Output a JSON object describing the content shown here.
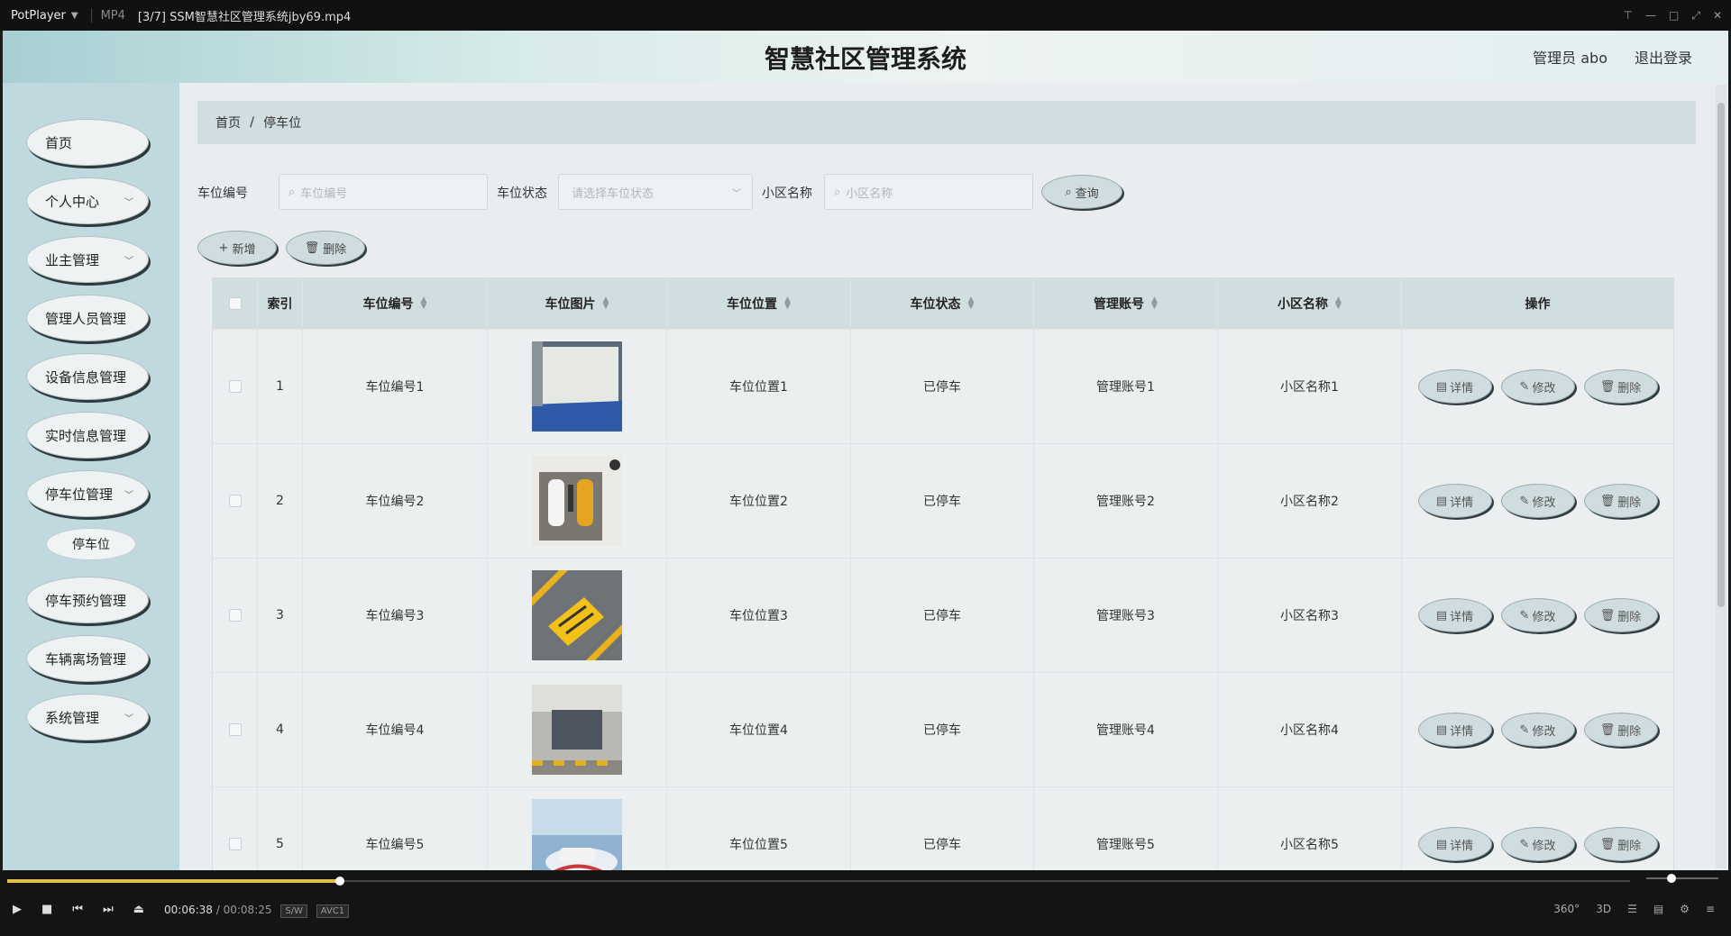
{
  "player": {
    "app_name": "PotPlayer",
    "format": "MP4",
    "file_title": "[3/7] SSM智慧社区管理系统jby69.mp4",
    "current_time": "00:06:38",
    "separator": "/",
    "total_time": "00:08:25",
    "tag1": "S/W",
    "tag2": "AVC1",
    "progress": 0.205,
    "volume_level": 0.35,
    "right_labels": [
      "360°",
      "3D"
    ]
  },
  "header": {
    "title": "智慧社区管理系统",
    "user": "管理员 abo",
    "logout": "退出登录"
  },
  "sidebar": {
    "items": [
      {
        "label": "首页",
        "arrow": false
      },
      {
        "label": "个人中心",
        "arrow": true
      },
      {
        "label": "业主管理",
        "arrow": true
      },
      {
        "label": "管理人员管理",
        "arrow": false
      },
      {
        "label": "设备信息管理",
        "arrow": false
      },
      {
        "label": "实时信息管理",
        "arrow": false
      },
      {
        "label": "停车位管理",
        "arrow": true
      },
      {
        "label": "停车预约管理",
        "arrow": false
      },
      {
        "label": "车辆离场管理",
        "arrow": false
      },
      {
        "label": "系统管理",
        "arrow": true
      }
    ],
    "sub_item": "停车位"
  },
  "breadcrumb": {
    "home": "首页",
    "sep": "/",
    "current": "停车位"
  },
  "search": {
    "label1": "车位编号",
    "placeholder1": "车位编号",
    "label2": "车位状态",
    "placeholder2": "请选择车位状态",
    "label3": "小区名称",
    "placeholder3": "小区名称",
    "query": "查询"
  },
  "actions": {
    "add": "新增",
    "delete": "删除"
  },
  "table": {
    "headers": [
      "索引",
      "车位编号",
      "车位图片",
      "车位位置",
      "车位状态",
      "管理账号",
      "小区名称",
      "操作"
    ],
    "row_actions": {
      "detail": "详情",
      "edit": "修改",
      "delete": "删除"
    },
    "rows": [
      {
        "index": "1",
        "code": "车位编号1",
        "location": "车位位置1",
        "status": "已停车",
        "account": "管理账号1",
        "community": "小区名称1"
      },
      {
        "index": "2",
        "code": "车位编号2",
        "location": "车位位置2",
        "status": "已停车",
        "account": "管理账号2",
        "community": "小区名称2"
      },
      {
        "index": "3",
        "code": "车位编号3",
        "location": "车位位置3",
        "status": "已停车",
        "account": "管理账号3",
        "community": "小区名称3"
      },
      {
        "index": "4",
        "code": "车位编号4",
        "location": "车位位置4",
        "status": "已停车",
        "account": "管理账号4",
        "community": "小区名称4"
      },
      {
        "index": "5",
        "code": "车位编号5",
        "location": "车位位置5",
        "status": "已停车",
        "account": "管理账号5",
        "community": "小区名称5"
      }
    ]
  },
  "colors": {
    "accent": "#cfdde1",
    "sidebar": "#bfd9de",
    "progress": "#e0c04a"
  }
}
